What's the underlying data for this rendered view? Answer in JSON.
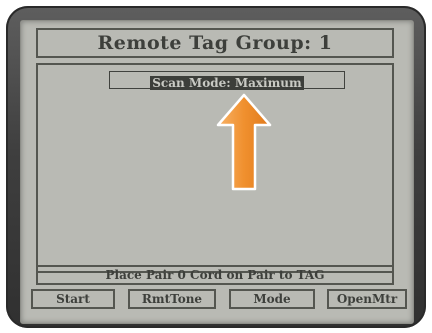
{
  "colors": {
    "screen_bg": "#b9bab4",
    "lcd_text": "#3d3f3b",
    "arrow": "#f0902e",
    "bezel": "#4a4a4a"
  },
  "title": "Remote Tag Group: 1",
  "scan_mode": "Scan Mode: Maximum",
  "status_message": "Place Pair 0 Cord on Pair to TAG",
  "softkeys": [
    "Start",
    "RmtTone",
    "Mode",
    "OpenMtr"
  ],
  "annotation": {
    "icon": "up-arrow-icon",
    "direction": "up"
  }
}
